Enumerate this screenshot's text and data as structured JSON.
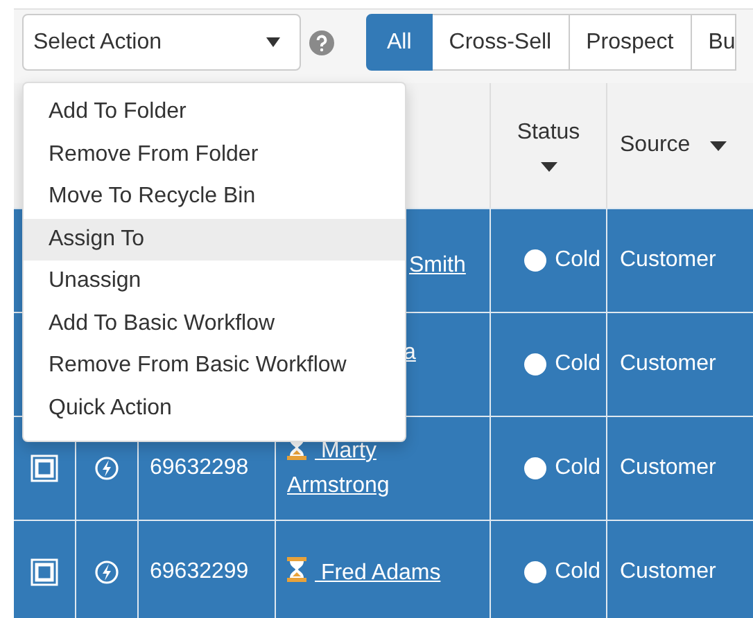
{
  "action_select": {
    "value": "Select Action"
  },
  "tabs": [
    {
      "label": "All",
      "selected": true
    },
    {
      "label": "Cross-Sell",
      "selected": false
    },
    {
      "label": "Prospect",
      "selected": false
    },
    {
      "label": "Bu",
      "selected": false
    }
  ],
  "action_menu": [
    {
      "label": "Add To Folder",
      "selected": false
    },
    {
      "label": "Remove From Folder",
      "selected": false
    },
    {
      "label": "Move To Recycle Bin",
      "selected": false
    },
    {
      "label": "Assign To",
      "selected": true
    },
    {
      "label": "Unassign",
      "selected": false
    },
    {
      "label": "Add To Basic Workflow",
      "selected": false
    },
    {
      "label": "Remove From Basic Workflow",
      "selected": false
    },
    {
      "label": "Quick Action",
      "selected": false
    }
  ],
  "table": {
    "columns": [
      {
        "label": "Status"
      },
      {
        "label": "Source"
      }
    ],
    "rows": [
      {
        "name": "Smith",
        "status": "Cold",
        "source": "Customer"
      },
      {
        "name": "a",
        "status": "Cold",
        "source": "Customer"
      },
      {
        "checkbox": true,
        "id": "69632298",
        "name": "Marty Armstrong",
        "status": "Cold",
        "source": "Customer"
      },
      {
        "checkbox": true,
        "id": "69632299",
        "name": "Fred Adams",
        "status": "Cold",
        "source": "Customer"
      }
    ]
  }
}
